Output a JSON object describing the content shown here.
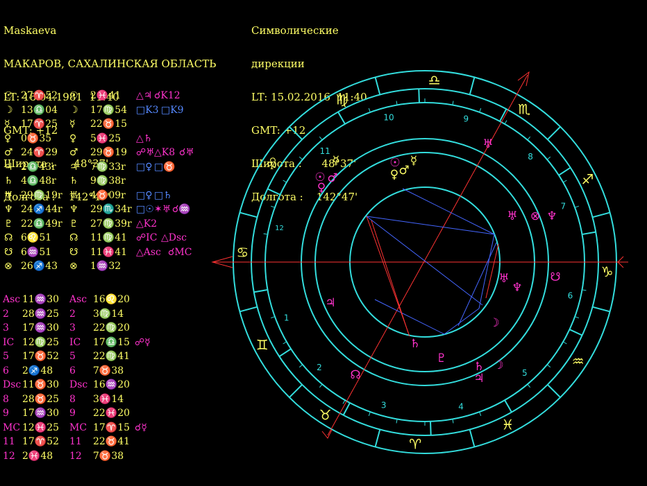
{
  "left_header": {
    "name": "Maskaeva",
    "place": "МАКАРОВ, САХАЛИНСКАЯ ОБЛАСТЬ",
    "lt": "LT: 18.04.1981  11:40",
    "gmt": "GMT: +12",
    "lat": "Широта :      48°37'",
    "lon": "Долгота :    142°47'"
  },
  "right_header": {
    "title1": "Символические",
    "title2": "дирекции",
    "lt": "LT: 15.02.2016  11:40",
    "gmt": "GMT: +12",
    "lat": "Широта :      48°37'",
    "lon": "Долгота :    142°47'"
  },
  "planets": [
    {
      "g": "☉",
      "n": "27♈52",
      "g2": "☉",
      "d": "2♓41",
      "asp": [
        {
          "t": "△♃",
          "c": "m"
        },
        {
          "t": "☌K12",
          "c": "m"
        }
      ]
    },
    {
      "g": "☽",
      "n": "13♎04",
      "g2": "☽",
      "d": "17♍54",
      "asp": [
        {
          "t": "□K3",
          "c": "b"
        },
        {
          "t": "□K9",
          "c": "b"
        }
      ]
    },
    {
      "g": "☿",
      "n": "17♈25",
      "g2": "☿",
      "d": "22♉15",
      "asp": []
    },
    {
      "g": "♀",
      "n": "0♉35",
      "g2": "♀",
      "d": "5♓25",
      "asp": [
        {
          "t": "△♄",
          "c": "m"
        }
      ]
    },
    {
      "g": "♂",
      "n": "24♈29",
      "g2": "♂",
      "d": "29♉19",
      "asp": [
        {
          "t": "☍♅",
          "c": "m"
        },
        {
          "t": "△K8",
          "c": "m"
        },
        {
          "t": "☌♅",
          "c": "m"
        }
      ]
    },
    {
      "g": "♃",
      "n": "2♎43r",
      "g2": "♃",
      "d": "7♍33r",
      "asp": [
        {
          "t": "□♀",
          "c": "b"
        },
        {
          "t": "□♉",
          "c": "b"
        }
      ]
    },
    {
      "g": "♄",
      "n": "4♎48r",
      "g2": "♄",
      "d": "9♍38r",
      "asp": []
    },
    {
      "g": "♅",
      "n": "29♍19r",
      "g2": "♅",
      "d": "4♉09r",
      "asp": [
        {
          "t": "□♀",
          "c": "b"
        },
        {
          "t": "□♄",
          "c": "b"
        }
      ]
    },
    {
      "g": "♆",
      "n": "24♐44r",
      "g2": "♆",
      "d": "29♏34r",
      "asp": [
        {
          "t": "□☉",
          "c": "b"
        },
        {
          "t": "✶♅",
          "c": "m"
        },
        {
          "t": "☌♒",
          "c": "m"
        }
      ]
    },
    {
      "g": "♇",
      "n": "22♎49r",
      "g2": "♇",
      "d": "27♍39r",
      "asp": [
        {
          "t": "△K2",
          "c": "m"
        }
      ]
    },
    {
      "g": "☊",
      "n": "6♌51",
      "g2": "☊",
      "d": "11♍41",
      "asp": [
        {
          "t": "☍IC",
          "c": "m"
        },
        {
          "t": "△Dsc",
          "c": "m"
        }
      ]
    },
    {
      "g": "☋",
      "n": "6♒51",
      "g2": "☋",
      "d": "11♓41",
      "asp": [
        {
          "t": "△Asc",
          "c": "m"
        },
        {
          "t": "☌MC",
          "c": "m"
        }
      ]
    },
    {
      "g": "⊗",
      "n": "26♐43",
      "g2": "⊗",
      "d": "1♒32",
      "asp": []
    }
  ],
  "houses": [
    {
      "k": "Asc",
      "n": "11♒30",
      "k2": "Asc",
      "d": "16♌20",
      "asp": []
    },
    {
      "k": "2",
      "n": "28♒25",
      "k2": "2",
      "d": "3♍14",
      "asp": []
    },
    {
      "k": "3",
      "n": "17♒30",
      "k2": "3",
      "d": "22♍20",
      "asp": []
    },
    {
      "k": "IC",
      "n": "12♍25",
      "k2": "IC",
      "d": "17♎15",
      "asp": [
        {
          "t": "☍☿",
          "c": "m"
        }
      ]
    },
    {
      "k": "5",
      "n": "17♉52",
      "k2": "5",
      "d": "22♍41",
      "asp": []
    },
    {
      "k": "6",
      "n": "2♐48",
      "k2": "6",
      "d": "7♉38",
      "asp": []
    },
    {
      "k": "Dsc",
      "n": "11♉30",
      "k2": "Dsc",
      "d": "16♒20",
      "asp": []
    },
    {
      "k": "8",
      "n": "28♉25",
      "k2": "8",
      "d": "3♓14",
      "asp": []
    },
    {
      "k": "9",
      "n": "17♒30",
      "k2": "9",
      "d": "22♓20",
      "asp": []
    },
    {
      "k": "MC",
      "n": "12♓25",
      "k2": "MC",
      "d": "17♈15",
      "asp": [
        {
          "t": "☌☿",
          "c": "m"
        }
      ]
    },
    {
      "k": "11",
      "n": "17♈52",
      "k2": "11",
      "d": "22♉41",
      "asp": []
    },
    {
      "k": "12",
      "n": "2♓48",
      "k2": "12",
      "d": "7♉38",
      "asp": []
    }
  ],
  "wheel": {
    "signs_ccw_from_east": [
      "♑",
      "♐",
      "♏",
      "♎",
      "♍",
      "♌",
      "♋",
      "♊",
      "♉",
      "♈",
      "♓",
      "♒"
    ],
    "house_numbers": [
      "1",
      "2",
      "3",
      "4",
      "5",
      "6",
      "7",
      "8",
      "9",
      "10",
      "11",
      "12"
    ],
    "natal_glyphs": [
      "☿",
      "☉",
      "♀",
      "♂",
      "♅",
      "⊗",
      "♆",
      "♆",
      "♅",
      "☋",
      "♃",
      "☽",
      "♄",
      "♇",
      "♄",
      "♃",
      "☽",
      "☊"
    ],
    "directed_glyphs": [
      "☿",
      "☉",
      "♀",
      "♂",
      "♅"
    ],
    "colors": {
      "ring": "#33dddd",
      "text": "#ffff66",
      "planet": "#ff33cc",
      "aspect_blue": "#4466ff",
      "aspect_red": "#ff3333",
      "axis": "#ff3333"
    }
  }
}
